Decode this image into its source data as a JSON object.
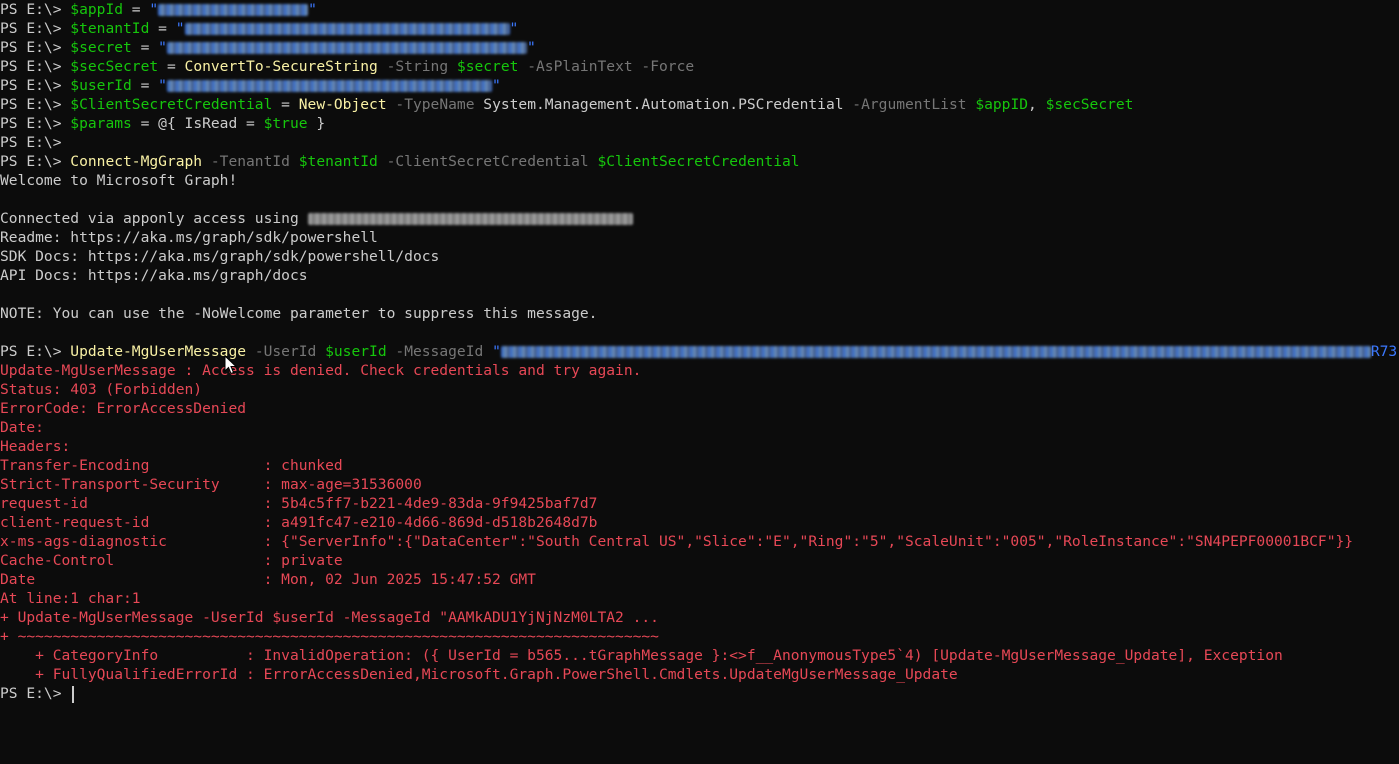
{
  "prompt": "PS E:\\> ",
  "lines": [
    {
      "type": "cmd",
      "segs": [
        [
          "ps",
          "PS E:\\> "
        ],
        [
          "var",
          "$appId"
        ],
        [
          "plain",
          " = "
        ],
        [
          "str",
          "\""
        ],
        [
          "blur",
          "150"
        ],
        [
          "str",
          "\""
        ]
      ]
    },
    {
      "type": "cmd",
      "segs": [
        [
          "ps",
          "PS E:\\> "
        ],
        [
          "var",
          "$tenantId"
        ],
        [
          "plain",
          " = "
        ],
        [
          "str",
          "\""
        ],
        [
          "blur",
          "325"
        ],
        [
          "str",
          "\""
        ]
      ]
    },
    {
      "type": "cmd",
      "segs": [
        [
          "ps",
          "PS E:\\> "
        ],
        [
          "var",
          "$secret"
        ],
        [
          "plain",
          " = "
        ],
        [
          "str",
          "\""
        ],
        [
          "blur",
          "360"
        ],
        [
          "str",
          "\""
        ]
      ]
    },
    {
      "type": "cmd",
      "segs": [
        [
          "ps",
          "PS E:\\> "
        ],
        [
          "var",
          "$secSecret"
        ],
        [
          "plain",
          " = "
        ],
        [
          "cmd",
          "ConvertTo-SecureString"
        ],
        [
          "param",
          " -String "
        ],
        [
          "var",
          "$secret"
        ],
        [
          "param",
          " -AsPlainText -Force"
        ]
      ]
    },
    {
      "type": "cmd",
      "segs": [
        [
          "ps",
          "PS E:\\> "
        ],
        [
          "var",
          "$userId"
        ],
        [
          "plain",
          " = "
        ],
        [
          "str",
          "\""
        ],
        [
          "blur",
          "325"
        ],
        [
          "str",
          "\""
        ]
      ]
    },
    {
      "type": "cmd",
      "segs": [
        [
          "ps",
          "PS E:\\> "
        ],
        [
          "var",
          "$ClientSecretCredential"
        ],
        [
          "plain",
          " = "
        ],
        [
          "cmd",
          "New-Object"
        ],
        [
          "param",
          " -TypeName "
        ],
        [
          "plain",
          "System.Management.Automation.PSCredential"
        ],
        [
          "param",
          " -ArgumentList "
        ],
        [
          "var",
          "$appID"
        ],
        [
          "plain",
          ", "
        ],
        [
          "var",
          "$secSecret"
        ]
      ]
    },
    {
      "type": "cmd",
      "segs": [
        [
          "ps",
          "PS E:\\> "
        ],
        [
          "var",
          "$params"
        ],
        [
          "plain",
          " = @{ IsRead = "
        ],
        [
          "var",
          "$true"
        ],
        [
          "plain",
          " }"
        ]
      ]
    },
    {
      "type": "cmd",
      "segs": [
        [
          "ps",
          "PS E:\\>"
        ]
      ]
    },
    {
      "type": "cmd",
      "segs": [
        [
          "ps",
          "PS E:\\> "
        ],
        [
          "cmd",
          "Connect-MgGraph"
        ],
        [
          "param",
          " -TenantId "
        ],
        [
          "var",
          "$tenantId"
        ],
        [
          "param",
          " -ClientSecretCredential "
        ],
        [
          "var",
          "$ClientSecretCredential"
        ]
      ]
    },
    {
      "type": "out",
      "segs": [
        [
          "plain",
          "Welcome to Microsoft Graph!"
        ]
      ]
    },
    {
      "type": "blank",
      "segs": []
    },
    {
      "type": "out",
      "segs": [
        [
          "plain",
          "Connected via apponly access using "
        ],
        [
          "blurgray",
          "325"
        ]
      ]
    },
    {
      "type": "out",
      "segs": [
        [
          "plain",
          "Readme: https://aka.ms/graph/sdk/powershell"
        ]
      ]
    },
    {
      "type": "out",
      "segs": [
        [
          "plain",
          "SDK Docs: https://aka.ms/graph/sdk/powershell/docs"
        ]
      ]
    },
    {
      "type": "out",
      "segs": [
        [
          "plain",
          "API Docs: https://aka.ms/graph/docs"
        ]
      ]
    },
    {
      "type": "blank",
      "segs": []
    },
    {
      "type": "out",
      "segs": [
        [
          "plain",
          "NOTE: You can use the -NoWelcome parameter to suppress this message."
        ]
      ]
    },
    {
      "type": "blank",
      "segs": []
    },
    {
      "type": "cmd",
      "segs": [
        [
          "ps",
          "PS E:\\> "
        ],
        [
          "cmd",
          "Update-MgUserMessage"
        ],
        [
          "param",
          " -UserId "
        ],
        [
          "var",
          "$userId"
        ],
        [
          "param",
          " -MessageId "
        ],
        [
          "str",
          "\""
        ],
        [
          "blur",
          "870"
        ],
        [
          "str",
          "R73"
        ]
      ]
    },
    {
      "type": "err",
      "segs": [
        [
          "err",
          "Update-MgUserMessage : Access is denied. Check credentials and try again."
        ]
      ]
    },
    {
      "type": "err",
      "segs": [
        [
          "err",
          "Status: 403 (Forbidden)"
        ]
      ]
    },
    {
      "type": "err",
      "segs": [
        [
          "err",
          "ErrorCode: ErrorAccessDenied"
        ]
      ]
    },
    {
      "type": "err",
      "segs": [
        [
          "err",
          "Date:"
        ]
      ]
    },
    {
      "type": "err",
      "segs": [
        [
          "err",
          "Headers:"
        ]
      ]
    },
    {
      "type": "err",
      "segs": [
        [
          "err",
          "Transfer-Encoding             : chunked"
        ]
      ]
    },
    {
      "type": "err",
      "segs": [
        [
          "err",
          "Strict-Transport-Security     : max-age=31536000"
        ]
      ]
    },
    {
      "type": "err",
      "segs": [
        [
          "err",
          "request-id                    : 5b4c5ff7-b221-4de9-83da-9f9425baf7d7"
        ]
      ]
    },
    {
      "type": "err",
      "segs": [
        [
          "err",
          "client-request-id             : a491fc47-e210-4d66-869d-d518b2648d7b"
        ]
      ]
    },
    {
      "type": "err",
      "segs": [
        [
          "err",
          "x-ms-ags-diagnostic           : {\"ServerInfo\":{\"DataCenter\":\"South Central US\",\"Slice\":\"E\",\"Ring\":\"5\",\"ScaleUnit\":\"005\",\"RoleInstance\":\"SN4PEPF00001BCF\"}}"
        ]
      ]
    },
    {
      "type": "err",
      "segs": [
        [
          "err",
          "Cache-Control                 : private"
        ]
      ]
    },
    {
      "type": "err",
      "segs": [
        [
          "err",
          "Date                          : Mon, 02 Jun 2025 15:47:52 GMT"
        ]
      ]
    },
    {
      "type": "err",
      "segs": [
        [
          "err",
          "At line:1 char:1"
        ]
      ]
    },
    {
      "type": "err",
      "segs": [
        [
          "err",
          "+ Update-MgUserMessage -UserId $userId -MessageId \"AAMkADU1YjNjNzM0LTA2 ..."
        ]
      ]
    },
    {
      "type": "err",
      "segs": [
        [
          "err",
          "+ ~~~~~~~~~~~~~~~~~~~~~~~~~~~~~~~~~~~~~~~~~~~~~~~~~~~~~~~~~~~~~~~~~~~~~~~~~"
        ]
      ]
    },
    {
      "type": "err",
      "segs": [
        [
          "err",
          "    + CategoryInfo          : InvalidOperation: ({ UserId = b565...tGraphMessage }:<>f__AnonymousType5`4) [Update-MgUserMessage_Update], Exception"
        ]
      ]
    },
    {
      "type": "err",
      "segs": [
        [
          "err",
          "    + FullyQualifiedErrorId : ErrorAccessDenied,Microsoft.Graph.PowerShell.Cmdlets.UpdateMgUserMessage_Update"
        ]
      ]
    },
    {
      "type": "prompt",
      "segs": [
        [
          "ps",
          "PS E:\\> "
        ]
      ]
    }
  ]
}
